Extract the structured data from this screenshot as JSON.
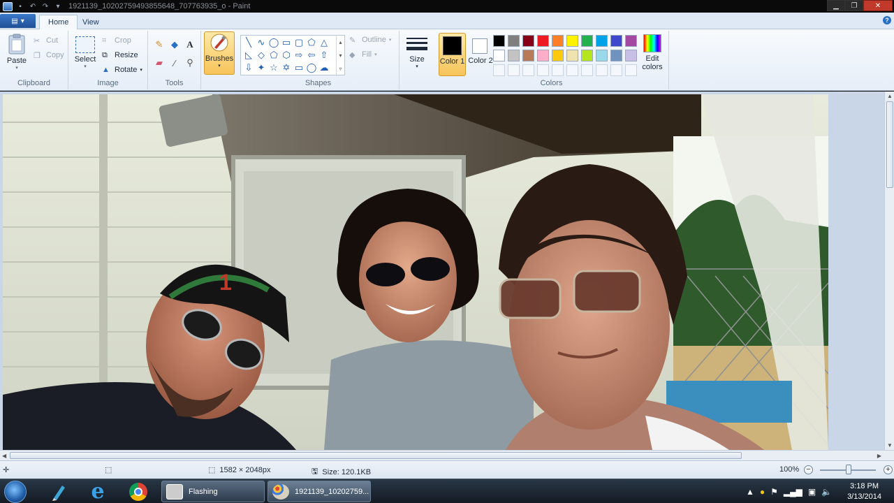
{
  "window": {
    "title": "1921139_10202759493855648_707763935_o - Paint",
    "controls": [
      "minimize",
      "maximize",
      "close"
    ]
  },
  "ribbon": {
    "tabs": [
      {
        "label": "Home",
        "active": true
      },
      {
        "label": "View",
        "active": false
      }
    ],
    "clipboard": {
      "paste": "Paste",
      "cut": "Cut",
      "copy": "Copy",
      "group": "Clipboard"
    },
    "image": {
      "select": "Select",
      "crop": "Crop",
      "resize": "Resize",
      "rotate": "Rotate",
      "group": "Image"
    },
    "tools": {
      "group": "Tools"
    },
    "brushes": {
      "label": "Brushes"
    },
    "shapes": {
      "outline": "Outline",
      "fill": "Fill",
      "group": "Shapes"
    },
    "size": {
      "label": "Size"
    },
    "colors": {
      "color1": "Color 1",
      "color2": "Color 2",
      "edit_colors": "Edit colors",
      "group": "Colors",
      "color1_value": "#000000",
      "color2_value": "#ffffff",
      "palette_row1": [
        "#000000",
        "#7f7f7f",
        "#880015",
        "#ed1c24",
        "#ff7f27",
        "#fff200",
        "#22b14c",
        "#00a2e8",
        "#3f48cc",
        "#a349a4"
      ],
      "palette_row2": [
        "#ffffff",
        "#c3c3c3",
        "#b97a57",
        "#ffaec9",
        "#ffc90e",
        "#efe4b0",
        "#b5e61d",
        "#99d9ea",
        "#7092be",
        "#c8bfe7"
      ]
    }
  },
  "status": {
    "dimensions": "1582 × 2048px",
    "size": "Size: 120.1KB",
    "zoom": "100%"
  },
  "taskbar": {
    "tasks": [
      {
        "label": "Flashing"
      },
      {
        "label": "1921139_10202759..."
      }
    ],
    "time": "3:18 PM",
    "date": "3/13/2014"
  }
}
